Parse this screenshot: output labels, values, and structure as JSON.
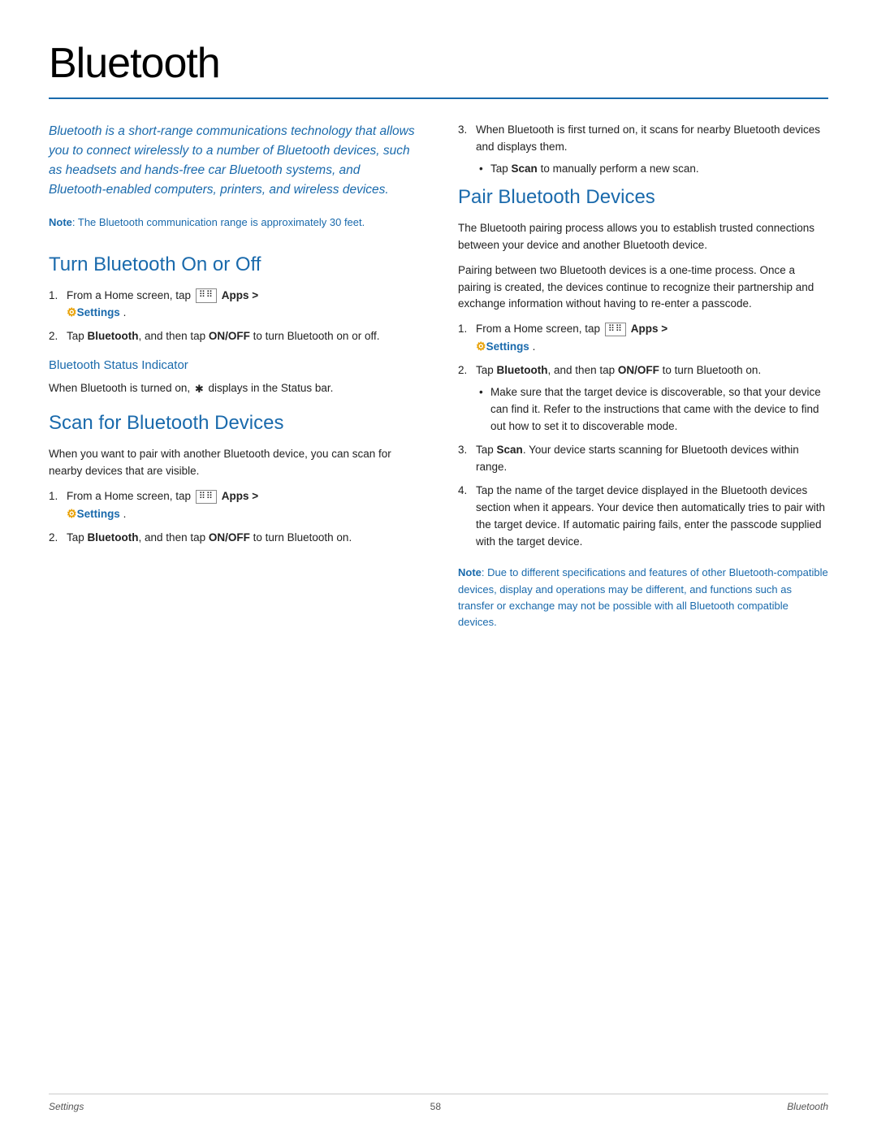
{
  "page": {
    "title": "Bluetooth",
    "footer": {
      "left": "Settings",
      "center": "58",
      "right": "Bluetooth"
    }
  },
  "intro": {
    "text": "Bluetooth is a short-range communications technology that allows you to connect wirelessly to a number of Bluetooth devices, such as headsets and hands-free car Bluetooth systems, and Bluetooth-enabled computers, printers, and wireless devices.",
    "note_label": "Note",
    "note_text": ": The Bluetooth communication range is approximately 30 feet."
  },
  "turn_on_off": {
    "title": "Turn Bluetooth On or Off",
    "steps": [
      {
        "num": "1.",
        "text_before": "From a Home screen, tap",
        "apps_label": "Apps >",
        "settings_label": "Settings",
        "text_after": "."
      },
      {
        "num": "2.",
        "text_before": "Tap",
        "bold1": "Bluetooth",
        "text_mid": ", and then tap",
        "bold2": "ON/OFF",
        "text_after": "to turn Bluetooth on or off."
      }
    ],
    "subsection_title": "Bluetooth Status Indicator",
    "subsection_text1": "When Bluetooth is turned on,",
    "subsection_text2": "displays in the Status bar."
  },
  "scan_devices": {
    "title": "Scan for Bluetooth Devices",
    "intro": "When you want to pair with another Bluetooth device, you can scan for nearby devices that are visible.",
    "steps": [
      {
        "num": "1.",
        "text_before": "From a Home screen, tap",
        "apps_label": "Apps >",
        "settings_label": "Settings",
        "text_after": "."
      },
      {
        "num": "2.",
        "text_before": "Tap",
        "bold1": "Bluetooth",
        "text_mid": ", and then tap",
        "bold2": "ON/OFF",
        "text_after": "to turn Bluetooth on."
      }
    ]
  },
  "pair_devices": {
    "title": "Pair Bluetooth Devices",
    "intro1": "The Bluetooth pairing process allows you to establish trusted connections between your device and another Bluetooth device.",
    "intro2": "Pairing between two Bluetooth devices is a one-time process. Once a pairing is created, the devices continue to recognize their partnership and exchange information without having to re-enter a passcode.",
    "steps": [
      {
        "num": "1.",
        "text_before": "From a Home screen, tap",
        "apps_label": "Apps >",
        "settings_label": "Settings",
        "text_after": "."
      },
      {
        "num": "2.",
        "text_before": "Tap",
        "bold1": "Bluetooth",
        "text_mid": ", and then tap",
        "bold2": "ON/OFF",
        "text_after": "to turn Bluetooth on.",
        "bullet": "Make sure that the target device is discoverable, so that your device can find it. Refer to the instructions that came with the device to find out how to set it to discoverable mode."
      },
      {
        "num": "3.",
        "text_before": "Tap",
        "bold1": "Scan",
        "text_after": ". Your device starts scanning for Bluetooth devices within range."
      },
      {
        "num": "4.",
        "text": "Tap the name of the target device displayed in the Bluetooth devices section when it appears. Your device then automatically tries to pair with the target device. If automatic pairing fails, enter the passcode supplied with the target device."
      }
    ],
    "right_scan_note": {
      "num": "3.",
      "text": "When Bluetooth is first turned on, it scans for nearby Bluetooth devices and displays them.",
      "bullet": "Tap",
      "bold": "Scan",
      "bullet_after": "to manually perform a new scan."
    },
    "note_label": "Note",
    "note_text": ": Due to different specifications and features of other Bluetooth-compatible devices, display and operations may be different, and functions such as transfer or exchange may not be possible with all Bluetooth compatible devices."
  }
}
